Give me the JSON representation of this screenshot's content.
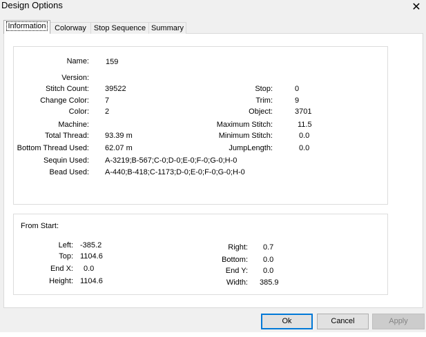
{
  "window": {
    "title": "Design Options",
    "close_glyph": "✕"
  },
  "tabs": [
    {
      "label": "Information",
      "active": true
    },
    {
      "label": "Colorway",
      "active": false
    },
    {
      "label": "Stop Sequence",
      "active": false
    },
    {
      "label": "Summary",
      "active": false
    }
  ],
  "info": {
    "name_label": "Name:",
    "name_value": "159",
    "version_label": "Version:",
    "version_value": "",
    "stitch_count_label": "Stitch Count:",
    "stitch_count_value": "39522",
    "change_color_label": "Change Color:",
    "change_color_value": "7",
    "color_label": "Color:",
    "color_value": "2",
    "machine_label": "Machine:",
    "machine_value": "",
    "total_thread_label": "Total Thread:",
    "total_thread_value": "93.39 m",
    "bottom_thread_label": "Bottom Thread Used:",
    "bottom_thread_value": "62.07 m",
    "sequin_label": "Sequin Used:",
    "sequin_value": "A-3219;B-567;C-0;D-0;E-0;F-0;G-0;H-0",
    "bead_label": "Bead Used:",
    "bead_value": "A-440;B-418;C-1173;D-0;E-0;F-0;G-0;H-0",
    "stop_label": "Stop:",
    "stop_value": "0",
    "trim_label": "Trim:",
    "trim_value": "9",
    "object_label": "Object:",
    "object_value": "3701",
    "max_stitch_label": "Maximum Stitch:",
    "max_stitch_value": "11.5",
    "min_stitch_label": "Minimum Stitch:",
    "min_stitch_value": "0.0",
    "jump_length_label": "JumpLength:",
    "jump_length_value": "0.0"
  },
  "from_start": {
    "heading": "From Start:",
    "left_label": "Left:",
    "left_value": "-385.2",
    "top_label": "Top:",
    "top_value": "1104.6",
    "endx_label": "End X:",
    "endx_value": "0.0",
    "height_label": "Height:",
    "height_value": "1104.6",
    "right_label": "Right:",
    "right_value": "0.7",
    "bottom_label": "Bottom:",
    "bottom_value": "0.0",
    "endy_label": "End Y:",
    "endy_value": "0.0",
    "width_label": "Width:",
    "width_value": "385.9"
  },
  "buttons": {
    "ok": "Ok",
    "cancel": "Cancel",
    "apply": "Apply"
  },
  "colors": {
    "accent": "#0078d7",
    "panel": "#ffffff",
    "window": "#f0f0f0"
  }
}
